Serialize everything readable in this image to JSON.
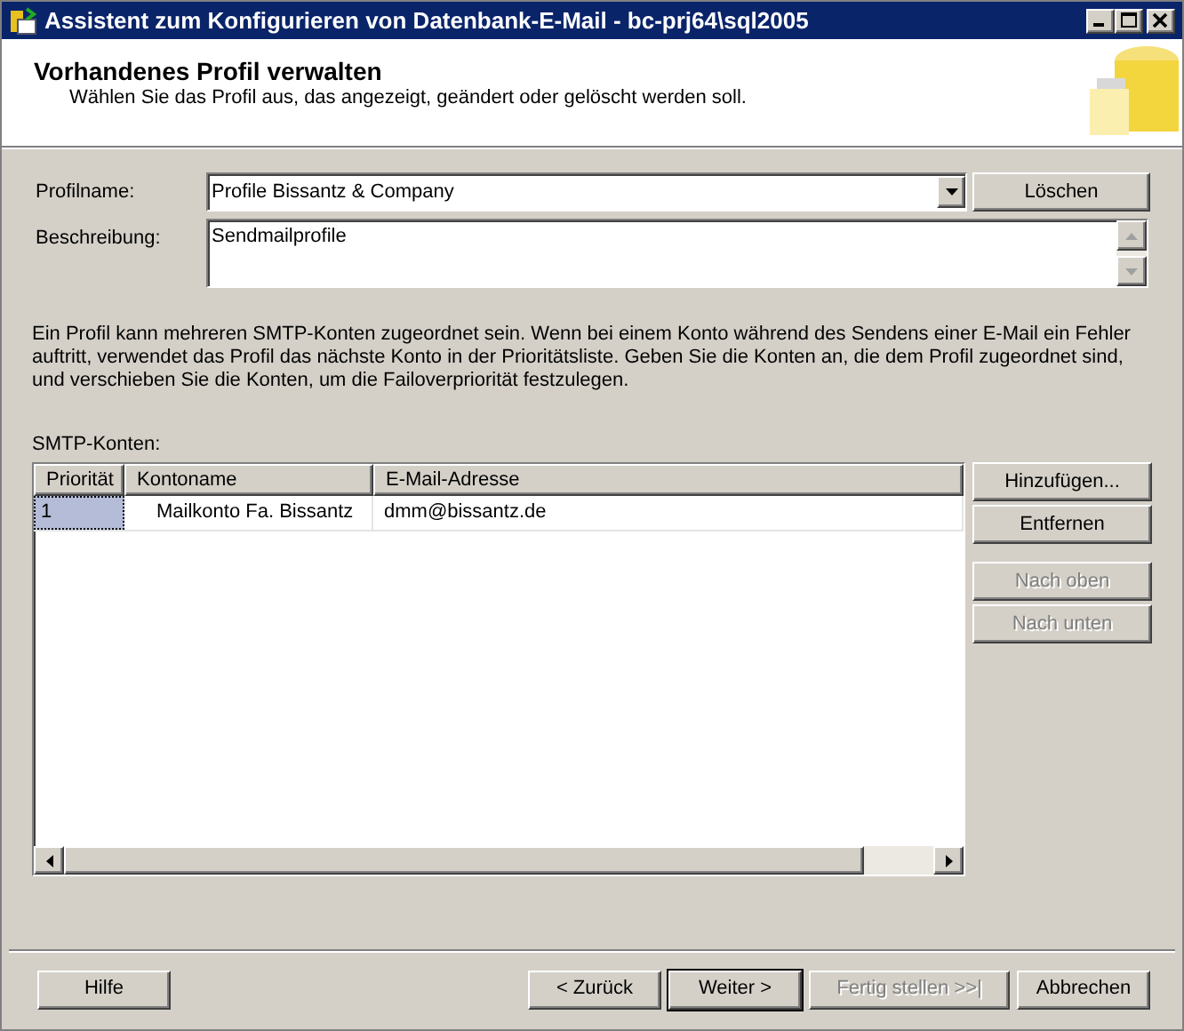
{
  "window": {
    "title": "Assistent zum Konfigurieren von Datenbank-E-Mail - bc-prj64\\sql2005"
  },
  "header": {
    "title": "Vorhandenes Profil verwalten",
    "subtitle": "Wählen Sie das Profil aus, das angezeigt, geändert oder gelöscht werden soll."
  },
  "profile": {
    "label": "Profilname:",
    "value": "Profile Bissantz & Company",
    "delete_button": "Löschen"
  },
  "description": {
    "label": "Beschreibung:",
    "value": "Sendmailprofile"
  },
  "info_text": "Ein Profil kann mehreren SMTP-Konten zugeordnet sein. Wenn bei einem Konto während des Sendens einer E-Mail ein Fehler auftritt, verwendet das Profil das nächste Konto in der Prioritätsliste. Geben Sie die Konten an, die dem Profil zugeordnet sind, und verschieben Sie die Konten, um die Failoverpriorität festzulegen.",
  "accounts": {
    "label": "SMTP-Konten:",
    "columns": [
      "Priorität",
      "Kontoname",
      "E-Mail-Adresse"
    ],
    "rows": [
      {
        "cells": [
          "1",
          "Mailkonto Fa. Bissantz",
          "dmm@bissantz.de"
        ],
        "selected": true
      }
    ],
    "buttons": [
      {
        "label": "Hinzufügen...",
        "disabled": false
      },
      {
        "label": "Entfernen",
        "disabled": false
      },
      {
        "label": "Nach oben",
        "disabled": true
      },
      {
        "label": "Nach unten",
        "disabled": true
      }
    ]
  },
  "footer": {
    "buttons": [
      {
        "label": "Hilfe",
        "disabled": false,
        "default": false
      },
      {
        "label": "< Zurück",
        "disabled": false,
        "default": false
      },
      {
        "label": "Weiter >",
        "disabled": false,
        "default": true
      },
      {
        "label": "Fertig stellen >>|",
        "disabled": true,
        "default": false
      },
      {
        "label": "Abbrechen",
        "disabled": false,
        "default": false
      }
    ]
  }
}
